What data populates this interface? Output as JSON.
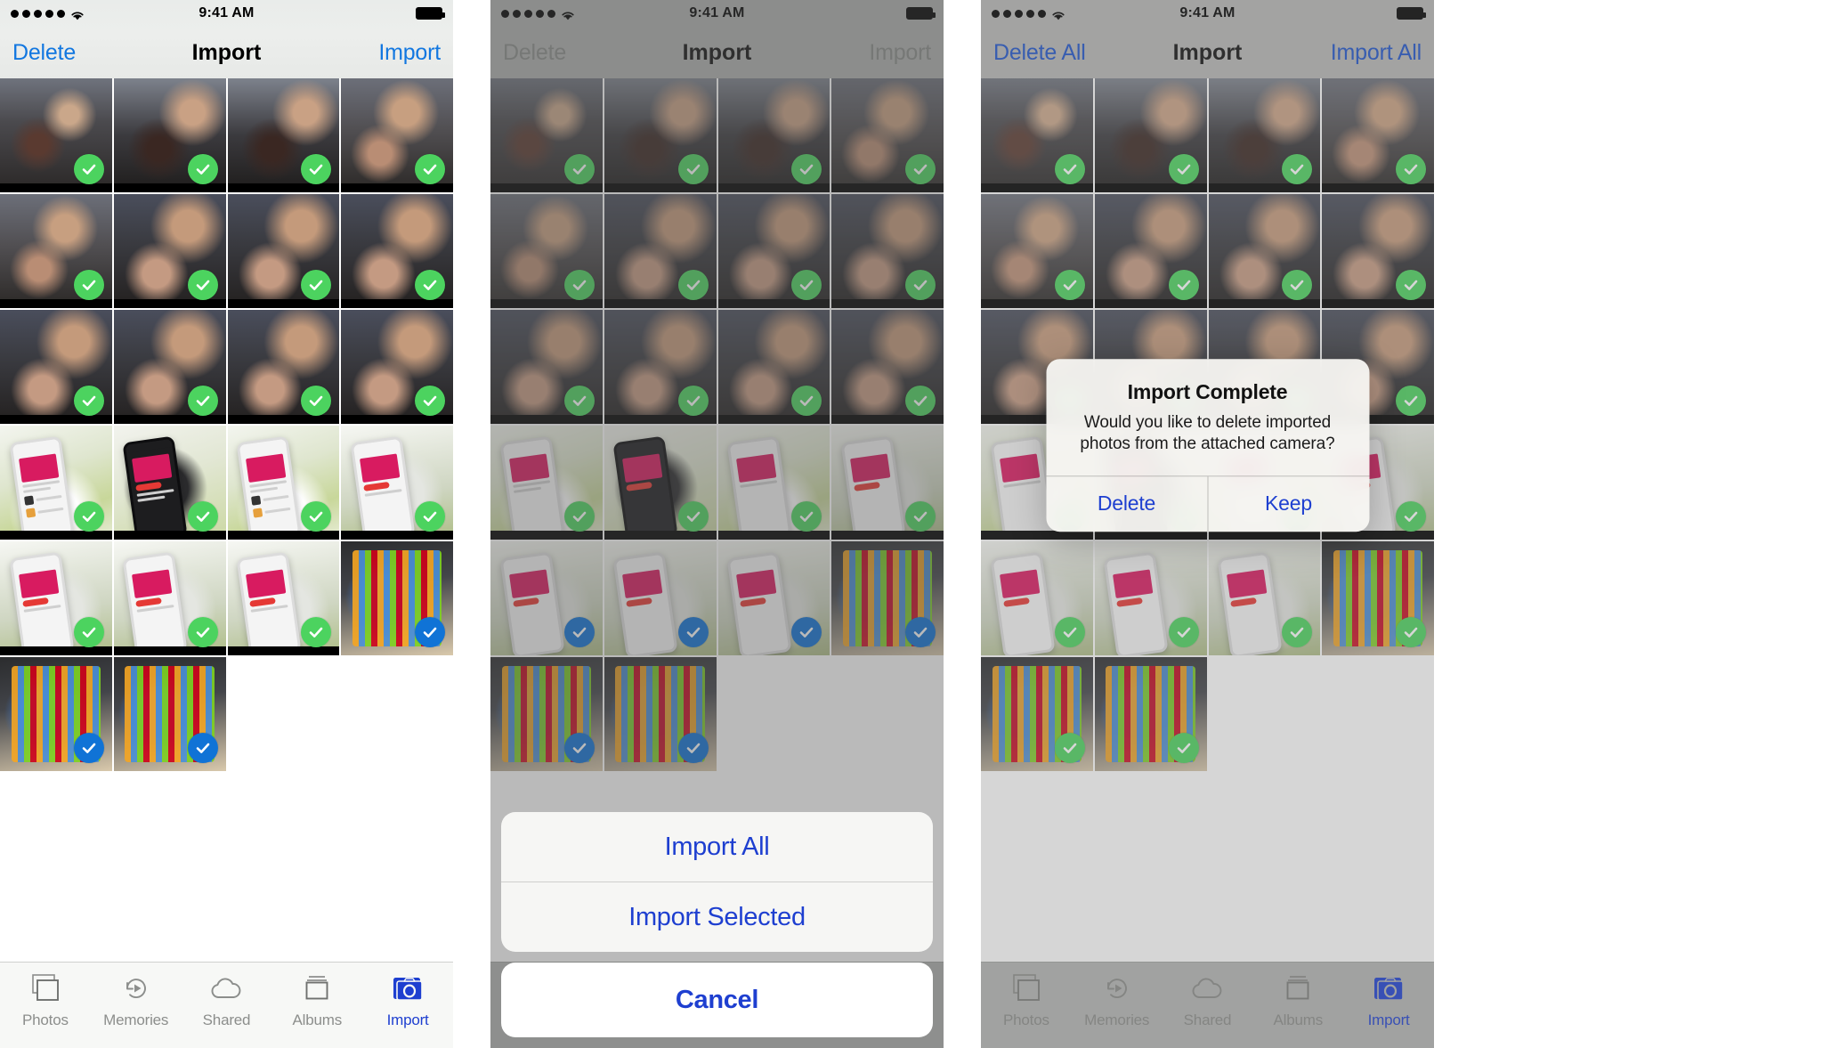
{
  "screens": [
    {
      "id": "selection",
      "status_bar": {
        "time": "9:41 AM",
        "signal_dots": 5,
        "wifi": "wifi-icon",
        "battery": "battery-full-icon"
      },
      "nav": {
        "left": "Delete",
        "title": "Import",
        "right": "Import",
        "left_enabled": true,
        "right_enabled": true
      },
      "grid": {
        "rows": [
          [
            {
              "scene": "a",
              "check": "green"
            },
            {
              "scene": "b",
              "check": "green"
            },
            {
              "scene": "b",
              "check": "green"
            },
            {
              "scene": "c",
              "check": "green"
            }
          ],
          [
            {
              "scene": "c",
              "check": "green"
            },
            {
              "scene": "d",
              "check": "green"
            },
            {
              "scene": "d",
              "check": "green"
            },
            {
              "scene": "d",
              "check": "green"
            }
          ],
          [
            {
              "scene": "d",
              "check": "green"
            },
            {
              "scene": "d",
              "check": "green"
            },
            {
              "scene": "d",
              "check": "green"
            },
            {
              "scene": "d",
              "check": "green"
            }
          ],
          [
            {
              "scene": "e",
              "check": "green"
            },
            {
              "scene": "f",
              "check": "green"
            },
            {
              "scene": "e",
              "check": "green"
            },
            {
              "scene": "h",
              "check": "green"
            }
          ],
          [
            {
              "scene": "h",
              "check": "green"
            },
            {
              "scene": "h",
              "check": "green"
            },
            {
              "scene": "h",
              "check": "green"
            },
            {
              "scene": "g",
              "check": "blue"
            }
          ],
          [
            {
              "scene": "g",
              "check": "blue"
            },
            {
              "scene": "g",
              "check": "blue"
            }
          ]
        ]
      },
      "tabbar": {
        "items": [
          {
            "label": "Photos",
            "icon": "photos-icon",
            "active": false
          },
          {
            "label": "Memories",
            "icon": "memories-icon",
            "active": false
          },
          {
            "label": "Shared",
            "icon": "shared-cloud-icon",
            "active": false
          },
          {
            "label": "Albums",
            "icon": "albums-icon",
            "active": false
          },
          {
            "label": "Import",
            "icon": "import-camera-icon",
            "active": true
          }
        ]
      }
    },
    {
      "id": "action-sheet",
      "status_bar": {
        "time": "9:41 AM",
        "signal_dots": 5,
        "wifi": "wifi-icon",
        "battery": "battery-full-icon"
      },
      "nav": {
        "left": "Delete",
        "title": "Import",
        "right": "Import",
        "left_enabled": false,
        "right_enabled": false
      },
      "action_sheet": {
        "options": [
          "Import All",
          "Import Selected"
        ],
        "cancel": "Cancel"
      },
      "tabbar": {
        "items": [
          {
            "label": "Photos",
            "icon": "photos-icon",
            "active": false
          },
          {
            "label": "Memories",
            "icon": "memories-icon",
            "active": false
          },
          {
            "label": "Shared",
            "icon": "shared-cloud-icon",
            "active": false
          },
          {
            "label": "Albums",
            "icon": "albums-icon",
            "active": false
          },
          {
            "label": "Import",
            "icon": "import-camera-icon",
            "active": true
          }
        ]
      }
    },
    {
      "id": "import-complete",
      "status_bar": {
        "time": "9:41 AM",
        "signal_dots": 5,
        "wifi": "wifi-icon",
        "battery": "battery-full-icon"
      },
      "nav": {
        "left": "Delete All",
        "title": "Import",
        "right": "Import All",
        "left_enabled": true,
        "right_enabled": true
      },
      "alert": {
        "title": "Import Complete",
        "message": "Would you like to delete imported photos from the attached camera?",
        "buttons": [
          "Delete",
          "Keep"
        ]
      },
      "tabbar": {
        "items": [
          {
            "label": "Photos",
            "icon": "photos-icon",
            "active": false
          },
          {
            "label": "Memories",
            "icon": "memories-icon",
            "active": false
          },
          {
            "label": "Shared",
            "icon": "shared-cloud-icon",
            "active": false
          },
          {
            "label": "Albums",
            "icon": "albums-icon",
            "active": false
          },
          {
            "label": "Import",
            "icon": "import-camera-icon",
            "active": true
          }
        ]
      }
    }
  ],
  "colors": {
    "tint_blue": "#1e3fd0",
    "nav_blue": "#1277e0",
    "check_green": "#4cd35f",
    "check_blue": "#1073d6",
    "disabled_gray": "#8b8b8b"
  }
}
